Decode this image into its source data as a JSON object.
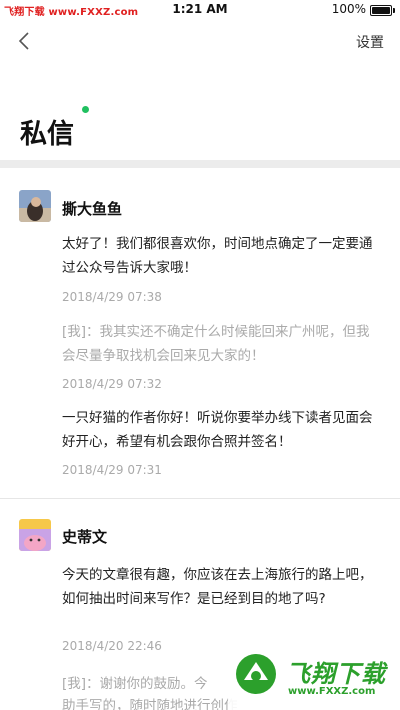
{
  "status": {
    "carrier_watermark": "飞翔下载 www.FXXZ.com",
    "time": "1:21 AM",
    "battery": "100%"
  },
  "nav": {
    "settings": "设置"
  },
  "page": {
    "title": "私信"
  },
  "conversations": [
    {
      "name": "撕大鱼鱼",
      "messages": [
        {
          "text": "太好了！我们都很喜欢你，时间地点确定了一定要通过公众号告诉大家哦！",
          "time": "2018/4/29  07:38"
        },
        {
          "text": "[我]：我其实还不确定什么时候能回来广州呢，但我会尽量争取找机会回来见大家的！",
          "time": "2018/4/29  07:32"
        },
        {
          "text": "一只好猫的作者你好！听说你要举办线下读者见面会好开心，希望有机会跟你合照并签名！",
          "time": "2018/4/29  07:31"
        }
      ]
    },
    {
      "name": "史蒂文",
      "messages": [
        {
          "text": "今天的文章很有趣，你应该在去上海旅行的路上吧，如何抽出时间来写作？是已经到目的地了吗?",
          "time": "2018/4/20  22:46"
        },
        {
          "text": "[我]：谢谢你的鼓励。今",
          "text2": "助手写的，随时随地进行创作"
        }
      ]
    }
  ],
  "watermark": {
    "brand": "飞翔下载",
    "url": "www.FXXZ.com"
  }
}
